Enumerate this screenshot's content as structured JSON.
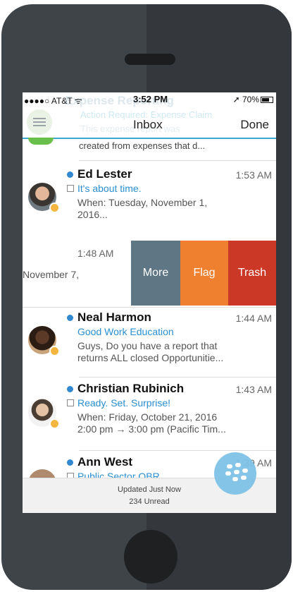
{
  "status": {
    "carrier": "●●●●○ AT&T ᯤ",
    "time": "3:52 PM",
    "battery": "➚ 70%"
  },
  "ghost": {
    "title": "Expense Reporting",
    "line1": "Action Required: Expense Claim",
    "line2": "This expense report was"
  },
  "nav": {
    "title": "Inbox",
    "done": "Done"
  },
  "prev_snippet": "created from expenses that d...",
  "messages": [
    {
      "sender": "Ed Lester",
      "time": "1:53 AM",
      "subject": "It's about time.",
      "preview1": "When: Tuesday, November 1,",
      "preview2": "2016..."
    },
    {
      "sender": "Neal Harmon",
      "time": "1:44 AM",
      "subject": "Good Work Education",
      "preview1": "Guys, Do you have a report that",
      "preview2": "returns ALL closed Opportunitie..."
    },
    {
      "sender": "Christian Rubinich",
      "time": "1:43 AM",
      "subject": "Ready. Set. Surprise!",
      "preview1": "When: Friday, October 21, 2016",
      "preview2": "2:00 pm → 3:00 pm (Pacific Tim..."
    },
    {
      "sender": "Ann West",
      "time": "1:39 AM",
      "subject": "Public Sector QBR",
      "preview1": "",
      "preview2": ""
    }
  ],
  "swiped": {
    "time": "1:48 AM",
    "preview": "November 7,"
  },
  "actions": {
    "more": "More",
    "flag": "Flag",
    "trash": "Trash"
  },
  "footer": {
    "updated": "Updated Just Now",
    "unread": "234 Unread"
  },
  "colors": {
    "accent": "#2a8fd0",
    "more": "#5f7785",
    "flag": "#ef8030",
    "trash": "#cc3826",
    "presence": "#f4b63f"
  },
  "icons": {
    "menu": "hamburger-icon",
    "fab": "blackberry-icon",
    "calendar": "calendar-icon"
  }
}
